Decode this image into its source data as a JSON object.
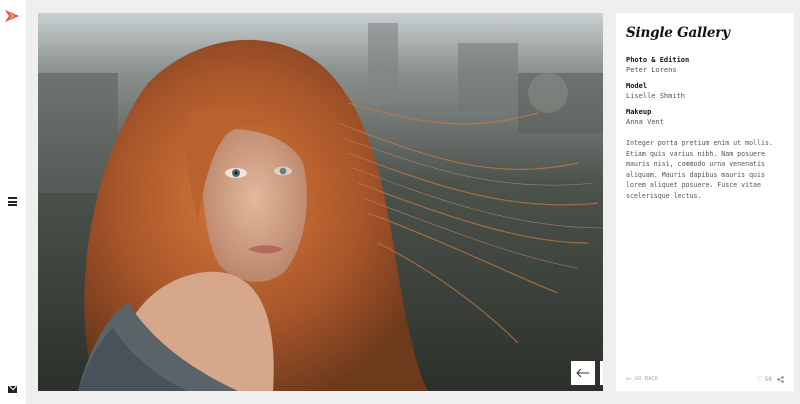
{
  "sidebar": {
    "logo_icon": "arrow-logo-icon",
    "menu_icon": "hamburger-menu-icon",
    "mail_icon": "envelope-icon",
    "accent_color": "#e84a3c"
  },
  "gallery": {
    "photo_description_icon": "photo",
    "prev_icon": "arrow-left-icon",
    "next_icon": "arrow-right-icon"
  },
  "info": {
    "title": "Single Gallery",
    "credits": [
      {
        "label": "Photo & Edition",
        "value": "Peter Lorens"
      },
      {
        "label": "Model",
        "value": "Liselle Shmith"
      },
      {
        "label": "Makeup",
        "value": "Anna Vent"
      }
    ],
    "description": "Integer porta pretium enim ut mollis. Etiam quis varius nibh. Nam posuere mauris nisi, commodo urna venenatis aliquam. Mauris dapibus mauris quis lorem aliquet posuere. Fusce vitae scelerisque lectus.",
    "go_back_label": "go back",
    "like_count": "56",
    "like_icon": "heart-icon",
    "share_icon": "share-icon"
  }
}
